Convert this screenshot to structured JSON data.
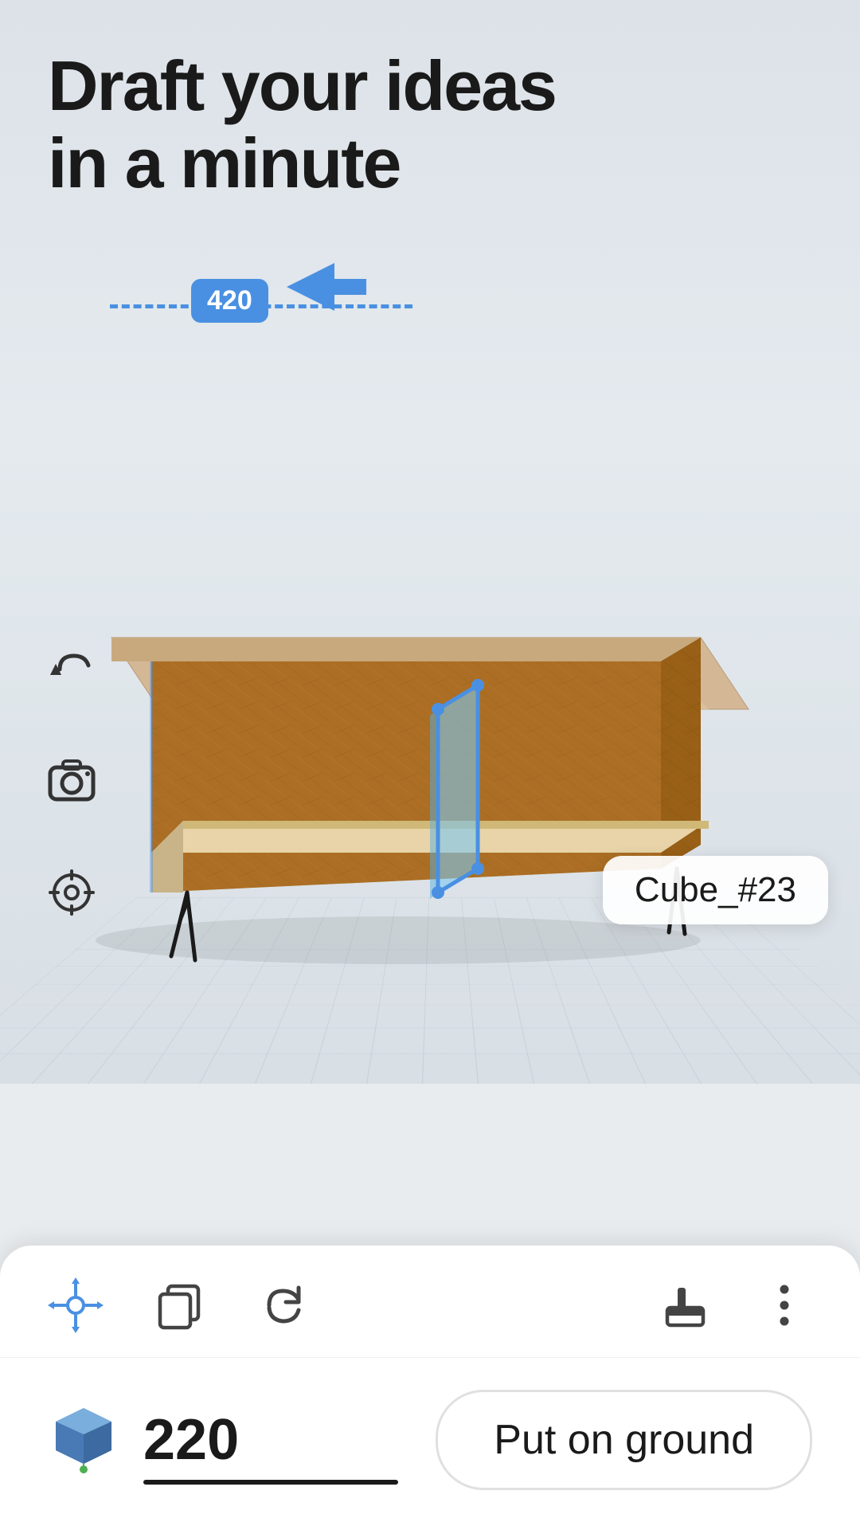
{
  "header": {
    "title_line1": "Draft your ideas",
    "title_line2": "in a minute"
  },
  "scene": {
    "object_label": "Cube_#23",
    "measurement_value": "420",
    "arrow_direction": "left"
  },
  "toolbar": {
    "undo_label": "undo",
    "move_label": "move",
    "copy_label": "copy",
    "paint_label": "paint",
    "more_label": "more"
  },
  "properties": {
    "height_value": "220",
    "put_on_ground_label": "Put on ground"
  },
  "icons": {
    "undo": "↩",
    "camera": "⊙",
    "target": "⊕",
    "move": "✥",
    "copy": "⧉",
    "reset": "↺",
    "paint": "⊓",
    "more": "⋮"
  }
}
